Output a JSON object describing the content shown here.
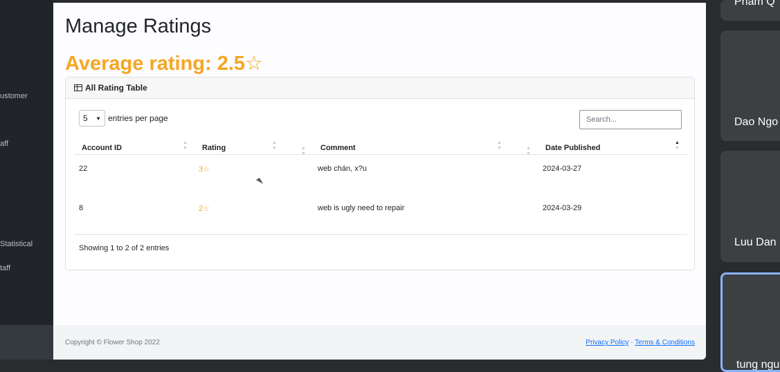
{
  "sidebar": {
    "items": [
      {
        "label": "ustomer"
      },
      {
        "label": "aff"
      },
      {
        "label": "Statistical"
      },
      {
        "label": "taff"
      }
    ]
  },
  "page": {
    "title": "Manage Ratings",
    "average_rating": "Average rating: 2.5☆"
  },
  "card": {
    "header": "All Rating Table",
    "entries_value": "5",
    "entries_label": "entries per page",
    "search_placeholder": "Search...",
    "columns": [
      "Account ID",
      "Rating",
      "Comment",
      "Date Published"
    ],
    "rows": [
      {
        "account_id": "22",
        "rating": "3☆",
        "comment": "web chán, x?u",
        "date": "2024-03-27"
      },
      {
        "account_id": "8",
        "rating": "2☆",
        "comment": "web is ugly need to repair",
        "date": "2024-03-29"
      }
    ],
    "showing": "Showing 1 to 2 of 2 entries"
  },
  "footer": {
    "copyright": "Copyright © Flower Shop 2022",
    "privacy": "Privacy Policy",
    "separator": "·",
    "terms": "Terms & Conditions"
  },
  "participants": [
    {
      "name": "Pham Q"
    },
    {
      "name": "Dao Ngo"
    },
    {
      "name": "Luu Dan"
    },
    {
      "name": "tung ngu"
    }
  ],
  "colors": {
    "accent": "#f5a623",
    "link": "#0d6efd",
    "active_tile": "#8ab4f8"
  }
}
